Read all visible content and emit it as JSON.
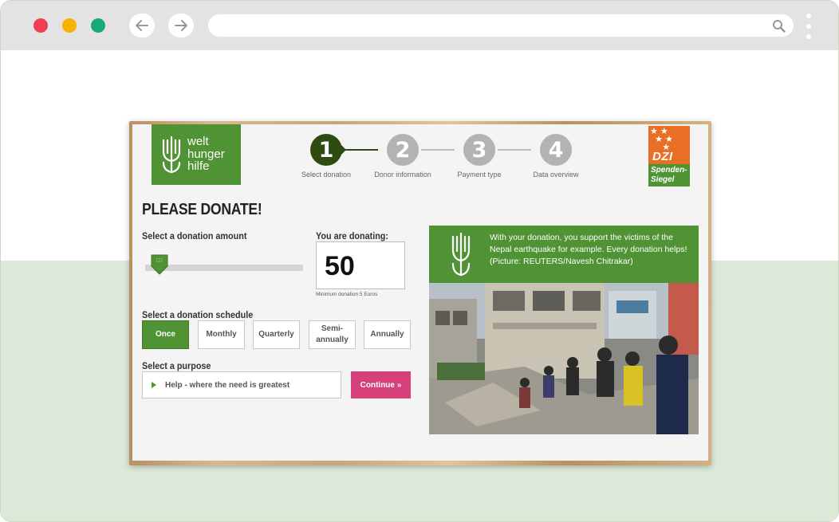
{
  "browser": {
    "url": ""
  },
  "logo": {
    "line1": "welt",
    "line2": "hunger",
    "line3": "hilfe"
  },
  "steps": [
    {
      "number": "1",
      "label": "Select donation",
      "active": true
    },
    {
      "number": "2",
      "label": "Donor information",
      "active": false
    },
    {
      "number": "3",
      "label": "Payment type",
      "active": false
    },
    {
      "number": "4",
      "label": "Data overview",
      "active": false
    }
  ],
  "seal": {
    "brand": "DZI",
    "line1": "Spenden-",
    "line2": "Siegel"
  },
  "form": {
    "title": "PLEASE DONATE!",
    "amount_label": "Select a donation amount",
    "donating_label": "You are donating:",
    "amount": "50",
    "min_note": "Minimum donation 5 Euros",
    "schedule_label": "Select a donation schedule",
    "schedule_options": [
      "Once",
      "Monthly",
      "Quarterly",
      "Semi-annually",
      "Annually"
    ],
    "schedule_selected": "Once",
    "purpose_label": "Select a purpose",
    "purpose_value": "Help - where the need is greatest",
    "continue_label": "Continue »",
    "slider_fraction": 0.02
  },
  "info": {
    "text": "With your donation, you support the victims of the Nepal earthquake for example. Every donation helps! (Picture: REUTERS/Navesh Chitrakar)"
  },
  "colors": {
    "brand_green": "#4f9334",
    "step_active": "#2e4c12",
    "continue_pink": "#d6407a",
    "dzi_orange": "#e86f25"
  }
}
